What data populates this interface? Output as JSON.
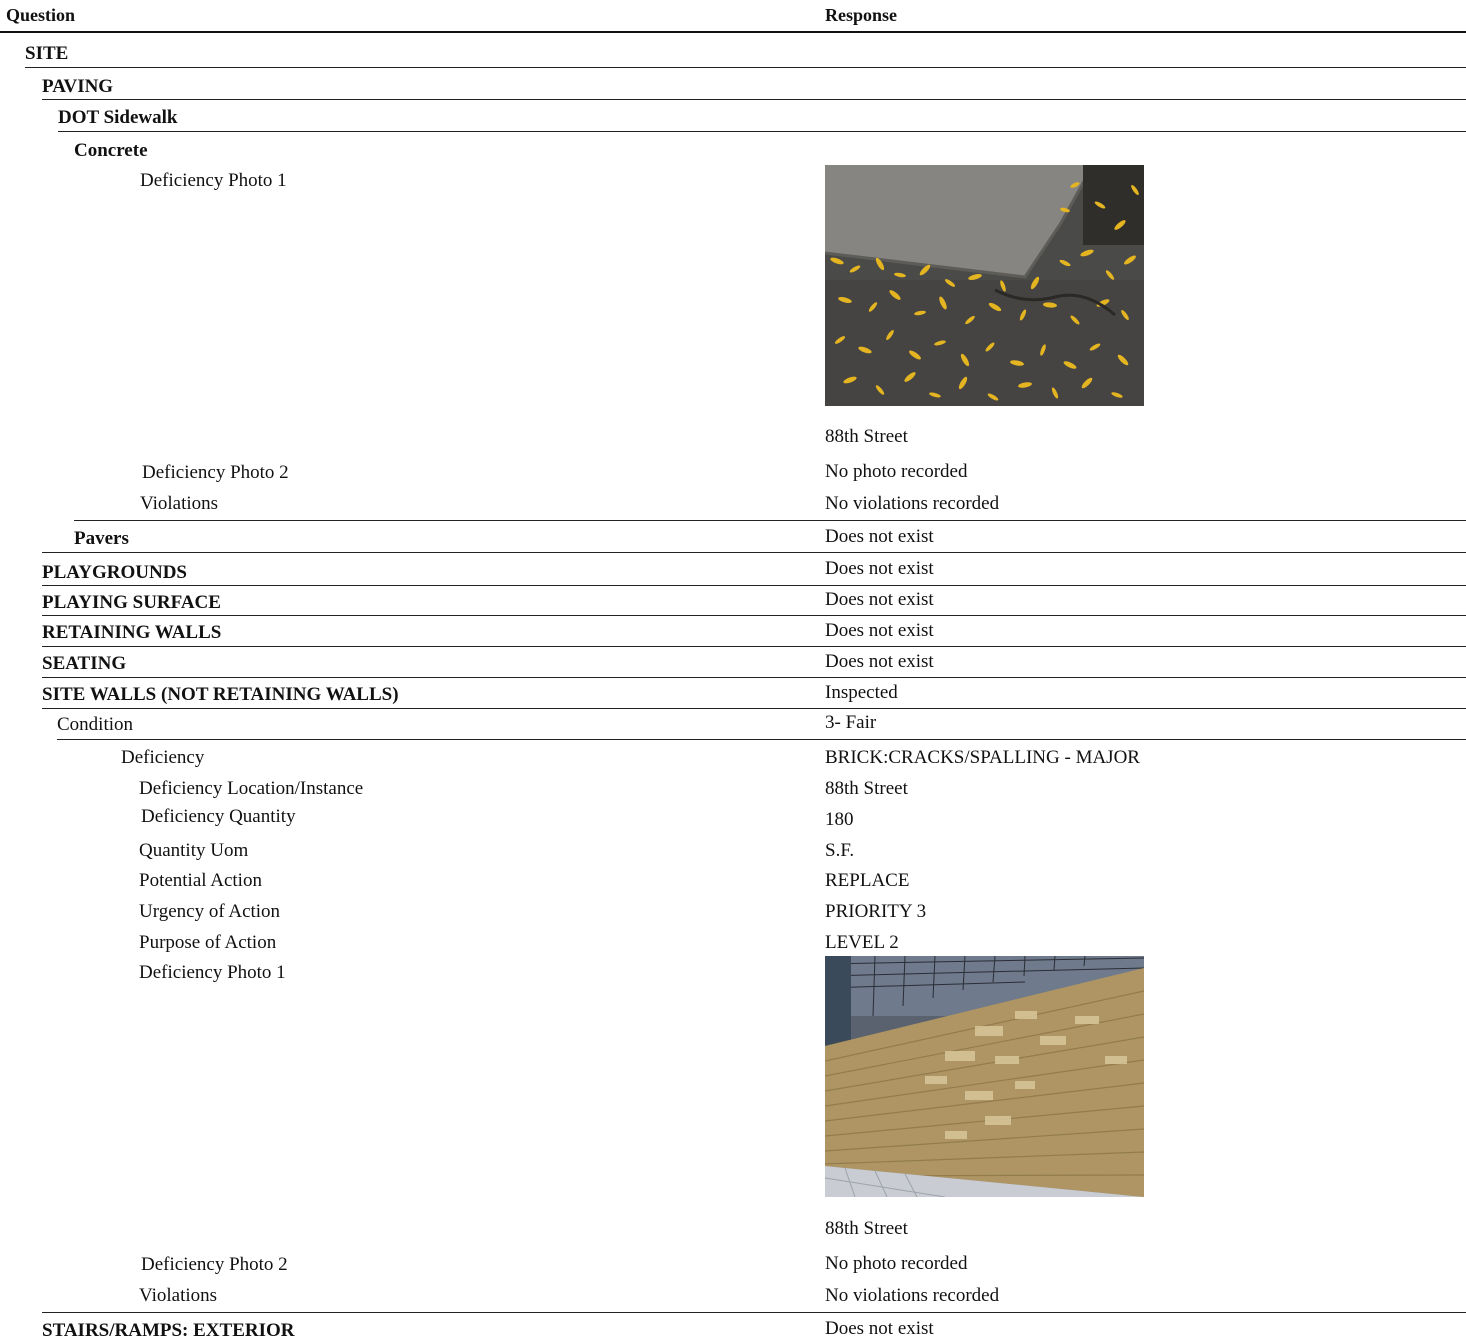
{
  "header": {
    "question": "Question",
    "response": "Response"
  },
  "sections": {
    "site": "SITE",
    "paving": "PAVING",
    "dot_sidewalk": "DOT Sidewalk",
    "concrete": "Concrete",
    "pavers": "Pavers",
    "playgrounds": "PLAYGROUNDS",
    "playing_surface": "PLAYING SURFACE",
    "retaining_walls": "RETAINING WALLS",
    "seating": "SEATING",
    "site_walls": "SITE WALLS (NOT RETAINING WALLS)",
    "stairs_ramps": "STAIRS/RAMPS: EXTERIOR"
  },
  "concrete": {
    "photo1_label": "Deficiency Photo 1",
    "photo1_caption": "88th Street",
    "photo2_label": "Deficiency Photo 2",
    "photo2_value": "No photo recorded",
    "violations_label": "Violations",
    "violations_value": "No violations recorded"
  },
  "responses": {
    "pavers": "Does not exist",
    "playgrounds": "Does not exist",
    "playing_surface": "Does not exist",
    "retaining_walls": "Does not exist",
    "seating": "Does not exist",
    "site_walls": "Inspected",
    "stairs_ramps": "Does not exist"
  },
  "site_walls": {
    "condition_label": "Condition",
    "condition_value": "3- Fair",
    "deficiency_label": "Deficiency",
    "deficiency_value": "BRICK:CRACKS/SPALLING - MAJOR",
    "location_label": "Deficiency Location/Instance",
    "location_value": "88th Street",
    "quantity_label": "Deficiency Quantity",
    "quantity_value": "180",
    "uom_label": "Quantity Uom",
    "uom_value": "S.F.",
    "action_label": "Potential Action",
    "action_value": "REPLACE",
    "urgency_label": "Urgency of Action",
    "urgency_value": "PRIORITY 3",
    "purpose_label": "Purpose of Action",
    "purpose_value": "LEVEL 2",
    "photo1_label": "Deficiency Photo 1",
    "photo1_caption": "88th Street",
    "photo2_label": "Deficiency Photo 2",
    "photo2_value": "No photo recorded",
    "violations_label": "Violations",
    "violations_value": "No violations recorded"
  }
}
